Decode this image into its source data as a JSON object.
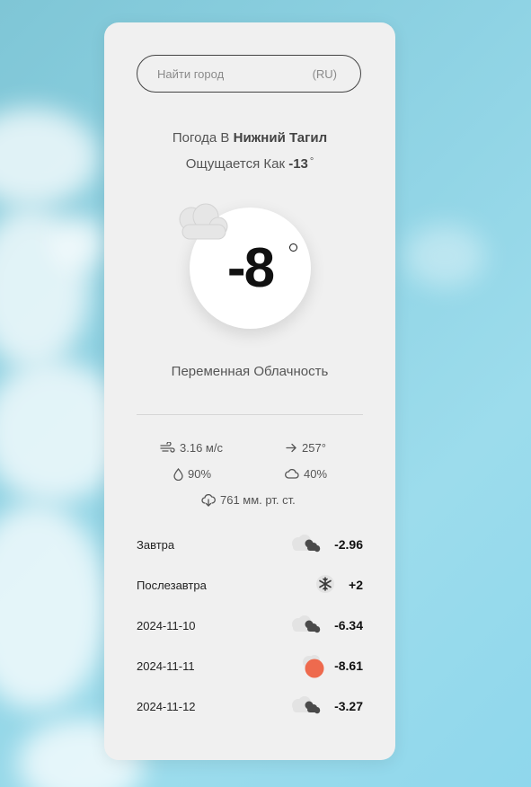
{
  "search": {
    "placeholder": "Найти город",
    "lang": "(RU)"
  },
  "location": {
    "prefix": "Погода В",
    "city": "Нижний Тагил"
  },
  "feels_like": {
    "prefix": "Ощущается Как",
    "value": "-13",
    "unit": "°"
  },
  "current": {
    "temperature": "-8",
    "icon": "cloud-icon",
    "condition": "Переменная Облачность"
  },
  "stats": {
    "wind_speed": "3.16 м/с",
    "wind_direction": "257°",
    "humidity": "90%",
    "cloudiness": "40%",
    "pressure": "761 мм. рт. ст."
  },
  "forecast": [
    {
      "day": "Завтра",
      "temp": "-2.96",
      "icon": "cloudy-icon"
    },
    {
      "day": "Послезавтра",
      "temp": "+2",
      "icon": "snowflake-icon"
    },
    {
      "day": "2024-11-10",
      "temp": "-6.34",
      "icon": "cloudy-icon"
    },
    {
      "day": "2024-11-11",
      "temp": "-8.61",
      "icon": "sun-cloud-icon"
    },
    {
      "day": "2024-11-12",
      "temp": "-3.27",
      "icon": "cloudy-icon"
    }
  ],
  "colors": {
    "card": "#f0f0f0",
    "sun": "#ee6a4e",
    "sky": "#8fd3e4"
  }
}
